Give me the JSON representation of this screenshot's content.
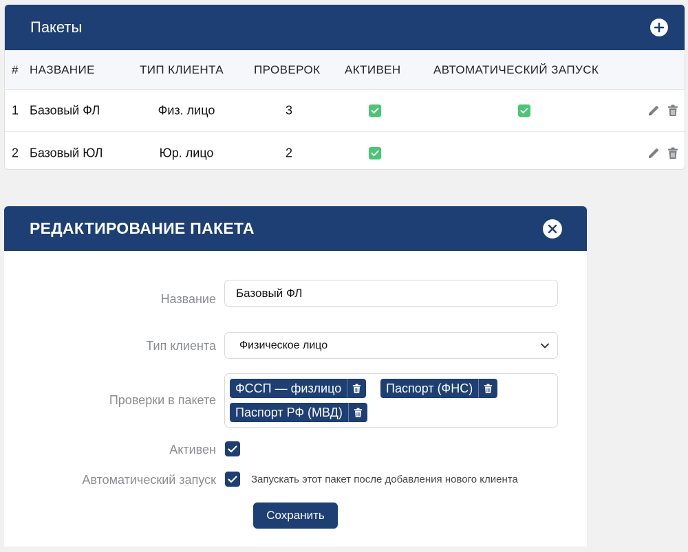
{
  "packages": {
    "title": "Пакеты",
    "columns": {
      "num": "#",
      "name": "НАЗВАНИЕ",
      "client_type": "ТИП КЛИЕНТА",
      "checks": "ПРОВЕРОК",
      "active": "АКТИВЕН",
      "auto_start": "АВТОМАТИЧЕСКИЙ ЗАПУСК"
    },
    "rows": [
      {
        "num": "1",
        "name": "Базовый ФЛ",
        "client_type": "Физ. лицо",
        "checks": "3",
        "active": true,
        "auto_start": true
      },
      {
        "num": "2",
        "name": "Базовый ЮЛ",
        "client_type": "Юр. лицо",
        "checks": "2",
        "active": true,
        "auto_start": false
      }
    ]
  },
  "edit_modal": {
    "title": "РЕДАКТИРОВАНИЕ ПАКЕТА",
    "name_label": "Название",
    "name_value": "Базовый ФЛ",
    "client_type_label": "Тип клиента",
    "client_type_value": "Физическое лицо",
    "checks_label": "Проверки в пакете",
    "checks": [
      "ФССП — физлицо",
      "Паспорт (ФНС)",
      "Паспорт РФ (МВД)"
    ],
    "active_label": "Активен",
    "active_checked": true,
    "auto_start_label": "Автоматический запуск",
    "auto_start_checked": true,
    "auto_start_hint": "Запускать этот пакет после добавления нового клиента",
    "save_label": "Сохранить"
  },
  "colors": {
    "brand": "#1d3f73",
    "success": "#48c774",
    "background": "#f1f1f1"
  },
  "icons": [
    "plus-circle-icon",
    "pencil-icon",
    "trash-icon",
    "close-circle-icon",
    "chevron-down-icon",
    "check-icon"
  ]
}
